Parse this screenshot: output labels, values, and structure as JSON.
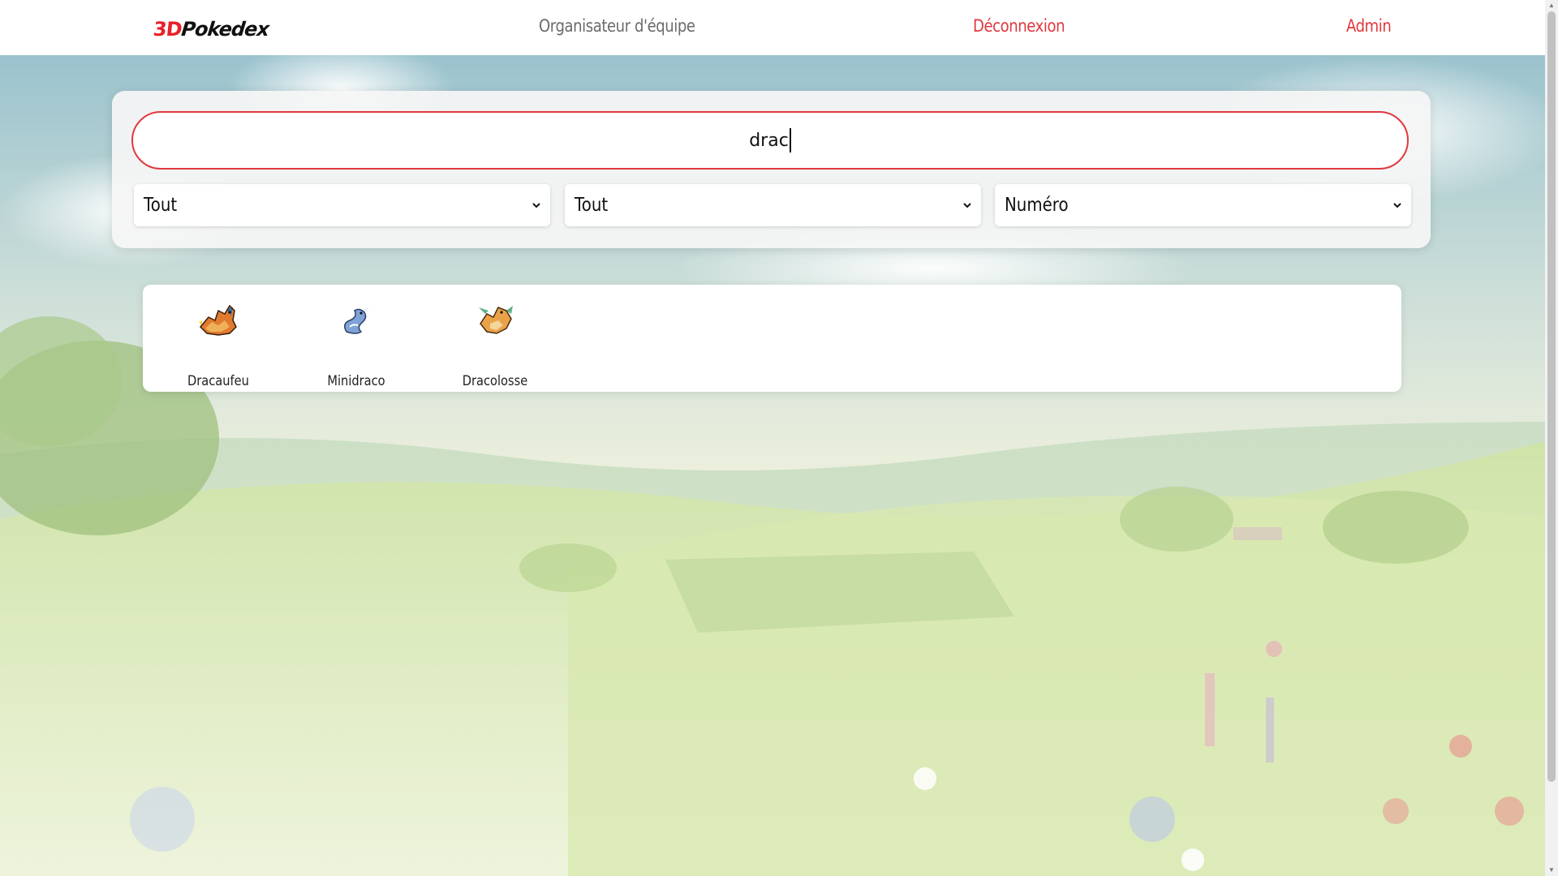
{
  "nav": {
    "logo_part1": "3D",
    "logo_part2": "Pokedex",
    "team_link": "Organisateur d'équipe",
    "logout_link": "Déconnexion",
    "admin_link": "Admin"
  },
  "search": {
    "value": "drac"
  },
  "filters": {
    "filter1": "Tout",
    "filter2": "Tout",
    "sort": "Numéro"
  },
  "results": [
    {
      "name": "Dracaufeu",
      "sprite_icon": "charizard-sprite-icon"
    },
    {
      "name": "Minidraco",
      "sprite_icon": "dratini-sprite-icon"
    },
    {
      "name": "Dracolosse",
      "sprite_icon": "dragonite-sprite-icon"
    }
  ],
  "colors": {
    "accent": "#e0383e",
    "nav_muted": "#6b6b6b"
  }
}
